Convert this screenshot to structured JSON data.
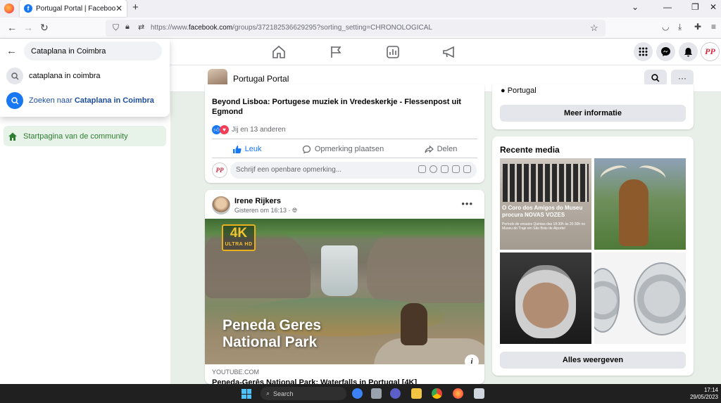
{
  "browser": {
    "tab_title": "Portugal Portal | Facebook",
    "tab_favicon": "f",
    "url_prefix": "https://www.",
    "url_domain": "facebook.com",
    "url_rest": "/groups/372182536629295?sorting_setting=CHRONOLOGICAL"
  },
  "search": {
    "query": "Cataplana in Coimbra",
    "suggestion_1": "cataplana in coimbra",
    "search_for_prefix": "Zoeken naar ",
    "search_for_term": "Cataplana in Coimbra"
  },
  "profile": {
    "initials": "PP"
  },
  "sidebar": {
    "community_home": "Startpagina van de community"
  },
  "group": {
    "name": "Portugal Portal"
  },
  "post1": {
    "title": "Beyond Lisboa: Portugese muziek in Vredeskerkje - Flessenpost uit Egmond",
    "reactions": "Jij en 13 anderen",
    "like": "Leuk",
    "comment": "Opmerking plaatsen",
    "share": "Delen",
    "comment_placeholder": "Schrijf een openbare opmerking..."
  },
  "post2": {
    "author": "Irene Rijkers",
    "time": "Gisteren om 16:13 · ",
    "badge_big": "4K",
    "badge_small": "ULTRA HD",
    "video_title_line1": "Peneda Geres",
    "video_title_line2": "National Park",
    "link_source": "YOUTUBE.COM",
    "link_title": "Peneda-Gerês National Park: Waterfalls in Portugal [4K]"
  },
  "right": {
    "location": "Portugal",
    "more_info": "Meer informatie",
    "recent_media": "Recente media",
    "media1_title": "O Coro dos Amigos do Museu procura NOVAS VOZES",
    "media1_sub": "Período de ensaios Quintas das 18:30h às 20:30h no Museu do Traje em São Brás de Alportel",
    "show_all": "Alles weergeven"
  },
  "taskbar": {
    "search": "Search",
    "time": "17:14",
    "date": "29/05/2023"
  },
  "colors": {
    "fb_blue": "#1877f2",
    "community_green": "#2e7d32",
    "love_red": "#f33e58"
  }
}
